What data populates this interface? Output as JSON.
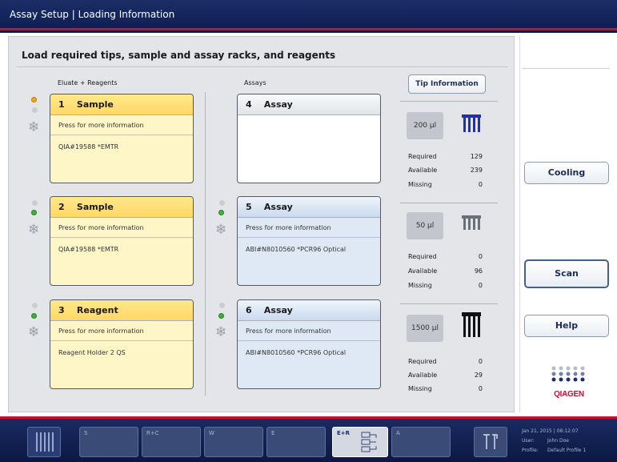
{
  "titlebar": {
    "title": "Assay Setup | Loading Information"
  },
  "main": {
    "title": "Load required tips, sample and assay racks, and reagents",
    "col_eluate_label": "Eluate + Reagents",
    "col_assays_label": "Assays",
    "tip_info_label": "Tip Information"
  },
  "slots": [
    {
      "number": "1",
      "name": "Sample",
      "info": "Press for more information",
      "value": "QIA#19588 *EMTR",
      "style": "yellow"
    },
    {
      "number": "2",
      "name": "Sample",
      "info": "Press for more information",
      "value": "QIA#19588 *EMTR",
      "style": "yellow"
    },
    {
      "number": "3",
      "name": "Reagent",
      "info": "Press for more information",
      "value": "Reagent Holder 2 QS",
      "style": "yellow"
    },
    {
      "number": "4",
      "name": "Assay",
      "info": "",
      "value": "",
      "style": "empty"
    },
    {
      "number": "5",
      "name": "Assay",
      "info": "Press for more information",
      "value": "ABI#N8010560 *PCR96 Optical",
      "style": "blue"
    },
    {
      "number": "6",
      "name": "Assay",
      "info": "Press for more information",
      "value": "ABI#N8010560 *PCR96 Optical",
      "style": "blue"
    }
  ],
  "tips": [
    {
      "volume": "200 µl",
      "required_label": "Required",
      "required": "129",
      "available_label": "Available",
      "available": "239",
      "missing_label": "Missing",
      "missing": "0",
      "icon_color": "#1f2fb8"
    },
    {
      "volume": "50 µl",
      "required_label": "Required",
      "required": "0",
      "available_label": "Available",
      "available": "96",
      "missing_label": "Missing",
      "missing": "0",
      "icon_color": "#6b6f78"
    },
    {
      "volume": "1500 µl",
      "required_label": "Required",
      "required": "0",
      "available_label": "Available",
      "available": "29",
      "missing_label": "Missing",
      "missing": "0",
      "icon_color": "#111111"
    }
  ],
  "side": {
    "cooling_label": "Cooling",
    "scan_label": "Scan",
    "help_label": "Help",
    "logo_text": "QIAGEN"
  },
  "taskbar": {
    "slots": [
      "S",
      "R+C",
      "W",
      "E",
      "E+R",
      "A"
    ],
    "datetime": "Jan 21, 2015 | 08:12:07",
    "user_label": "User:",
    "user": "John Doe",
    "profile_label": "Profile:",
    "profile": "Default Profile 1"
  },
  "colors": {
    "brand_blue": "#0f1f55",
    "accent_red": "#c8102e",
    "sample_yellow": "#ffd766",
    "assay_blue": "#cad9ee",
    "led_orange": "#f2a61a",
    "led_green": "#3db33a"
  }
}
